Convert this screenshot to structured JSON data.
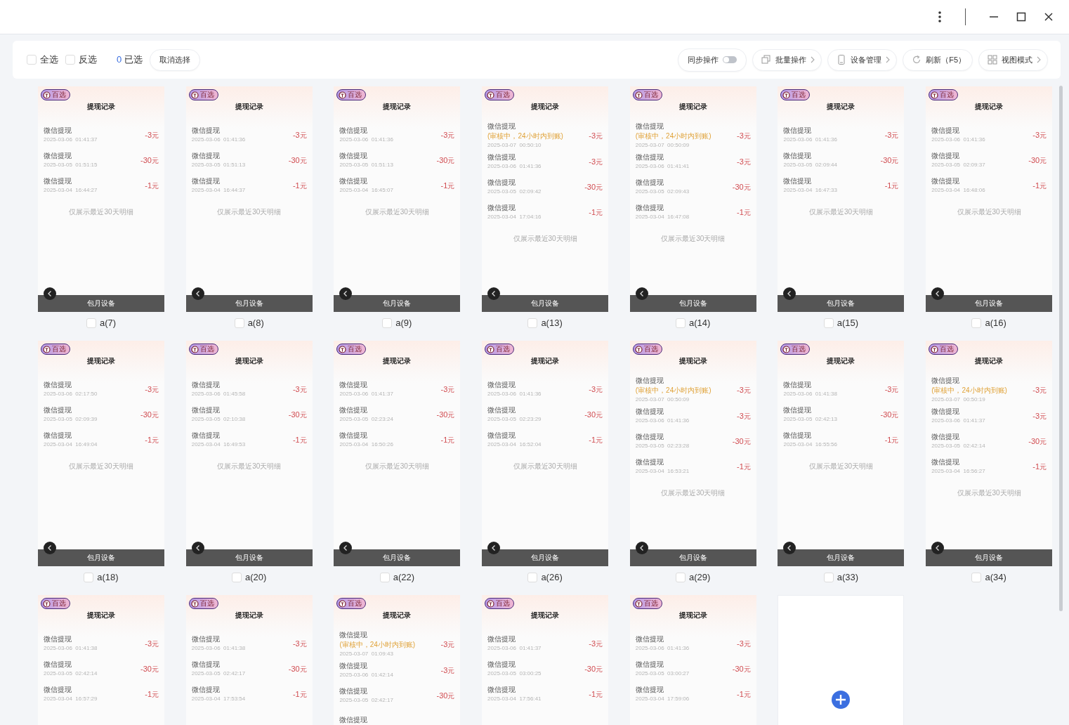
{
  "toolbar": {
    "select_all": {
      "label": "全选",
      "checked": false
    },
    "invert": {
      "label": "反选",
      "checked": false
    },
    "selected_count": "0",
    "selected_label": "已选",
    "clear_button": "取消选择",
    "sync": {
      "label": "同步操作",
      "on": false
    },
    "buttons": [
      {
        "label": "批量操作",
        "kind": "batch"
      },
      {
        "label": "设备管理",
        "kind": "device"
      },
      {
        "label": "刷新（F5）",
        "kind": "refresh"
      },
      {
        "label": "视图模式",
        "kind": "view"
      }
    ]
  },
  "devices": [
    {
      "kind": "device",
      "logo": "百选",
      "title": "提现记录",
      "records": [
        {
          "title": "微信提现",
          "time": "2025-03-06  01:41:37",
          "amount": "-3",
          "unit": "元"
        },
        {
          "title": "微信提现",
          "time": "2025-03-05  01:51:15",
          "amount": "-30",
          "unit": "元"
        },
        {
          "title": "微信提现",
          "time": "2025-03-04  16:44:27",
          "amount": "-1",
          "unit": "元"
        }
      ],
      "note": "仅展示最近30天明细",
      "footer": "包月设备",
      "name": "a(7)",
      "checked": false
    },
    {
      "kind": "device",
      "logo": "百选",
      "title": "提现记录",
      "records": [
        {
          "title": "微信提现",
          "time": "2025-03-06  01:41:36",
          "amount": "-3",
          "unit": "元"
        },
        {
          "title": "微信提现",
          "time": "2025-03-05  01:51:13",
          "amount": "-30",
          "unit": "元"
        },
        {
          "title": "微信提现",
          "time": "2025-03-04  16:44:37",
          "amount": "-1",
          "unit": "元"
        }
      ],
      "note": "仅展示最近30天明细",
      "footer": "包月设备",
      "name": "a(8)",
      "checked": false
    },
    {
      "kind": "device",
      "logo": "百选",
      "title": "提现记录",
      "records": [
        {
          "title": "微信提现",
          "time": "2025-03-06  01:41:36",
          "amount": "-3",
          "unit": "元"
        },
        {
          "title": "微信提现",
          "time": "2025-03-05  01:51:13",
          "amount": "-30",
          "unit": "元"
        },
        {
          "title": "微信提现",
          "time": "2025-03-04  16:45:07",
          "amount": "-1",
          "unit": "元"
        }
      ],
      "note": "仅展示最近30天明细",
      "footer": "包月设备",
      "name": "a(9)",
      "checked": false
    },
    {
      "kind": "device",
      "logo": "百选",
      "title": "提现记录",
      "records": [
        {
          "title": "微信提现",
          "tag": "(审核中，24小时内到账)",
          "time": "2025-03-07  00:50:10",
          "amount": "-3",
          "unit": "元"
        },
        {
          "title": "微信提现",
          "time": "2025-03-06  01:41:36",
          "amount": "-3",
          "unit": "元"
        },
        {
          "title": "微信提现",
          "time": "2025-03-05  02:09:42",
          "amount": "-30",
          "unit": "元"
        },
        {
          "title": "微信提现",
          "time": "2025-03-04  17:04:16",
          "amount": "-1",
          "unit": "元"
        }
      ],
      "note": "仅展示最近30天明细",
      "footer": "包月设备",
      "name": "a(13)",
      "checked": false
    },
    {
      "kind": "device",
      "logo": "百选",
      "title": "提现记录",
      "records": [
        {
          "title": "微信提现",
          "tag": "(审核中，24小时内到账)",
          "time": "2025-03-07  00:50:09",
          "amount": "-3",
          "unit": "元"
        },
        {
          "title": "微信提现",
          "time": "2025-03-06  01:41:41",
          "amount": "-3",
          "unit": "元"
        },
        {
          "title": "微信提现",
          "time": "2025-03-05  02:09:43",
          "amount": "-30",
          "unit": "元"
        },
        {
          "title": "微信提现",
          "time": "2025-03-04  16:47:08",
          "amount": "-1",
          "unit": "元"
        }
      ],
      "note": "仅展示最近30天明细",
      "footer": "包月设备",
      "name": "a(14)",
      "checked": false
    },
    {
      "kind": "device",
      "logo": "百选",
      "title": "提现记录",
      "records": [
        {
          "title": "微信提现",
          "time": "2025-03-06  01:41:36",
          "amount": "-3",
          "unit": "元"
        },
        {
          "title": "微信提现",
          "time": "2025-03-05  02:09:44",
          "amount": "-30",
          "unit": "元"
        },
        {
          "title": "微信提现",
          "time": "2025-03-04  16:47:33",
          "amount": "-1",
          "unit": "元"
        }
      ],
      "note": "仅展示最近30天明细",
      "footer": "包月设备",
      "name": "a(15)",
      "checked": false
    },
    {
      "kind": "device",
      "logo": "百选",
      "title": "提现记录",
      "records": [
        {
          "title": "微信提现",
          "time": "2025-03-06  01:41:36",
          "amount": "-3",
          "unit": "元"
        },
        {
          "title": "微信提现",
          "time": "2025-03-05  02:09:37",
          "amount": "-30",
          "unit": "元"
        },
        {
          "title": "微信提现",
          "time": "2025-03-04  16:48:06",
          "amount": "-1",
          "unit": "元"
        }
      ],
      "note": "仅展示最近30天明细",
      "footer": "包月设备",
      "name": "a(16)",
      "checked": false
    },
    {
      "kind": "device",
      "logo": "百选",
      "title": "提现记录",
      "records": [
        {
          "title": "微信提现",
          "time": "2025-03-06  02:17:50",
          "amount": "-3",
          "unit": "元"
        },
        {
          "title": "微信提现",
          "time": "2025-03-05  02:09:39",
          "amount": "-30",
          "unit": "元"
        },
        {
          "title": "微信提现",
          "time": "2025-03-04  16:49:04",
          "amount": "-1",
          "unit": "元"
        }
      ],
      "note": "仅展示最近30天明细",
      "footer": "包月设备",
      "name": "a(18)",
      "checked": false
    },
    {
      "kind": "device",
      "logo": "百选",
      "title": "提现记录",
      "records": [
        {
          "title": "微信提现",
          "time": "2025-03-06  01:45:58",
          "amount": "-3",
          "unit": "元"
        },
        {
          "title": "微信提现",
          "time": "2025-03-05  02:10:38",
          "amount": "-30",
          "unit": "元"
        },
        {
          "title": "微信提现",
          "time": "2025-03-04  16:49:53",
          "amount": "-1",
          "unit": "元"
        }
      ],
      "note": "仅展示最近30天明细",
      "footer": "包月设备",
      "name": "a(20)",
      "checked": false
    },
    {
      "kind": "device",
      "logo": "百选",
      "title": "提现记录",
      "records": [
        {
          "title": "微信提现",
          "time": "2025-03-06  01:41:37",
          "amount": "-3",
          "unit": "元"
        },
        {
          "title": "微信提现",
          "time": "2025-03-05  02:23:24",
          "amount": "-30",
          "unit": "元"
        },
        {
          "title": "微信提现",
          "time": "2025-03-04  16:50:26",
          "amount": "-1",
          "unit": "元"
        }
      ],
      "note": "仅展示最近30天明细",
      "footer": "包月设备",
      "name": "a(22)",
      "checked": false
    },
    {
      "kind": "device",
      "logo": "百选",
      "title": "提现记录",
      "records": [
        {
          "title": "微信提现",
          "time": "2025-03-06  01:41:36",
          "amount": "-3",
          "unit": "元"
        },
        {
          "title": "微信提现",
          "time": "2025-03-05  02:23:29",
          "amount": "-30",
          "unit": "元"
        },
        {
          "title": "微信提现",
          "time": "2025-03-04  16:52:04",
          "amount": "-1",
          "unit": "元"
        }
      ],
      "note": "仅展示最近30天明细",
      "footer": "包月设备",
      "name": "a(26)",
      "checked": false
    },
    {
      "kind": "device",
      "logo": "百选",
      "title": "提现记录",
      "records": [
        {
          "title": "微信提现",
          "tag": "(审核中，24小时内到账)",
          "time": "2025-03-07  00:50:09",
          "amount": "-3",
          "unit": "元"
        },
        {
          "title": "微信提现",
          "time": "2025-03-06  01:41:36",
          "amount": "-3",
          "unit": "元"
        },
        {
          "title": "微信提现",
          "time": "2025-03-05  02:23:28",
          "amount": "-30",
          "unit": "元"
        },
        {
          "title": "微信提现",
          "time": "2025-03-04  16:53:21",
          "amount": "-1",
          "unit": "元"
        }
      ],
      "note": "仅展示最近30天明细",
      "footer": "包月设备",
      "name": "a(29)",
      "checked": false
    },
    {
      "kind": "device",
      "logo": "百选",
      "title": "提现记录",
      "records": [
        {
          "title": "微信提现",
          "time": "2025-03-06  01:41:38",
          "amount": "-3",
          "unit": "元"
        },
        {
          "title": "微信提现",
          "time": "2025-03-05  02:42:13",
          "amount": "-30",
          "unit": "元"
        },
        {
          "title": "微信提现",
          "time": "2025-03-04  16:55:56",
          "amount": "-1",
          "unit": "元"
        }
      ],
      "note": "仅展示最近30天明细",
      "footer": "包月设备",
      "name": "a(33)",
      "checked": false
    },
    {
      "kind": "device",
      "logo": "百选",
      "title": "提现记录",
      "records": [
        {
          "title": "微信提现",
          "tag": "(审核中，24小时内到账)",
          "time": "2025-03-07  00:50:19",
          "amount": "-3",
          "unit": "元"
        },
        {
          "title": "微信提现",
          "time": "2025-03-06  01:41:37",
          "amount": "-3",
          "unit": "元"
        },
        {
          "title": "微信提现",
          "time": "2025-03-05  02:42:14",
          "amount": "-30",
          "unit": "元"
        },
        {
          "title": "微信提现",
          "time": "2025-03-04  16:56:27",
          "amount": "-1",
          "unit": "元"
        }
      ],
      "note": "仅展示最近30天明细",
      "footer": "包月设备",
      "name": "a(34)",
      "checked": false
    },
    {
      "kind": "device",
      "logo": "百选",
      "title": "提现记录",
      "records": [
        {
          "title": "微信提现",
          "time": "2025-03-06  01:41:38",
          "amount": "-3",
          "unit": "元"
        },
        {
          "title": "微信提现",
          "time": "2025-03-05  02:42:14",
          "amount": "-30",
          "unit": "元"
        },
        {
          "title": "微信提现",
          "time": "2025-03-04  16:57:29",
          "amount": "-1",
          "unit": "元"
        }
      ]
    },
    {
      "kind": "device",
      "logo": "百选",
      "title": "提现记录",
      "records": [
        {
          "title": "微信提现",
          "time": "2025-03-06  01:41:38",
          "amount": "-3",
          "unit": "元"
        },
        {
          "title": "微信提现",
          "time": "2025-03-05  02:42:17",
          "amount": "-30",
          "unit": "元"
        },
        {
          "title": "微信提现",
          "time": "2025-03-04  17:53:54",
          "amount": "-1",
          "unit": "元"
        }
      ]
    },
    {
      "kind": "device",
      "logo": "百选",
      "title": "提现记录",
      "records": [
        {
          "title": "微信提现",
          "tag": "(审核中，24小时内到账)",
          "time": "2025-03-07  01:09:43",
          "amount": "-3",
          "unit": "元"
        },
        {
          "title": "微信提现",
          "time": "2025-03-06  01:42:14",
          "amount": "-3",
          "unit": "元"
        },
        {
          "title": "微信提现",
          "time": "2025-03-05  02:42:17",
          "amount": "-30",
          "unit": "元"
        },
        {
          "title": "微信提现"
        }
      ]
    },
    {
      "kind": "device",
      "logo": "百选",
      "title": "提现记录",
      "records": [
        {
          "title": "微信提现",
          "time": "2025-03-06  01:41:37",
          "amount": "-3",
          "unit": "元"
        },
        {
          "title": "微信提现",
          "time": "2025-03-05  03:00:25",
          "amount": "-30",
          "unit": "元"
        },
        {
          "title": "微信提现",
          "time": "2025-03-04  17:56:41",
          "amount": "-1",
          "unit": "元"
        }
      ]
    },
    {
      "kind": "device",
      "logo": "百选",
      "title": "提现记录",
      "records": [
        {
          "title": "微信提现",
          "time": "2025-03-06  01:41:36",
          "amount": "-3",
          "unit": "元"
        },
        {
          "title": "微信提现",
          "time": "2025-03-05  03:00:27",
          "amount": "-30",
          "unit": "元"
        },
        {
          "title": "微信提现",
          "time": "2025-03-04  17:59:06",
          "amount": "-1",
          "unit": "元"
        }
      ]
    },
    {
      "kind": "add"
    }
  ]
}
